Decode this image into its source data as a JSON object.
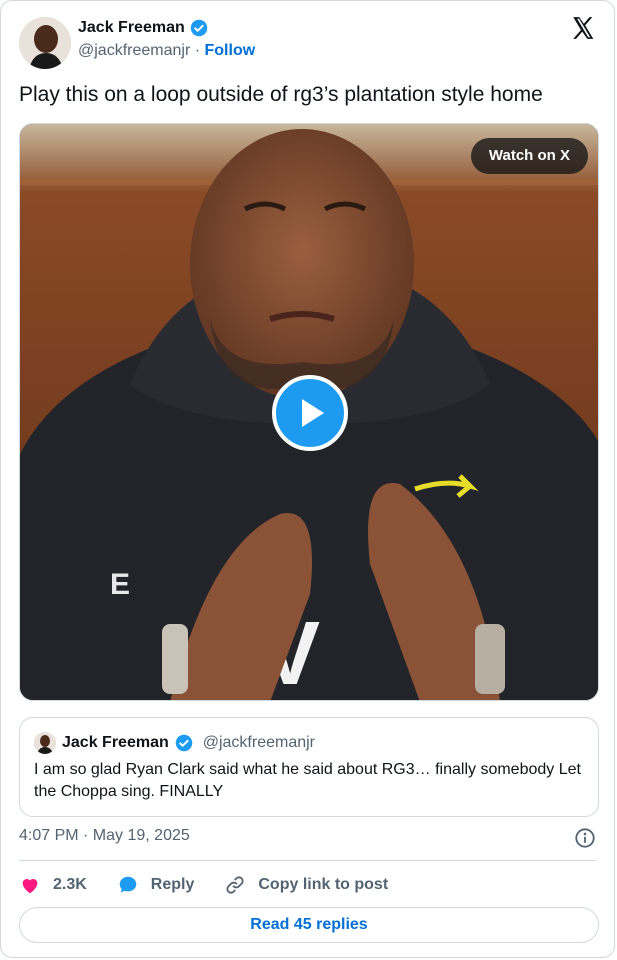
{
  "author": {
    "name": "Jack Freeman",
    "handle": "@jackfreemanjr",
    "separator": " · ",
    "follow_label": "Follow"
  },
  "tweet": {
    "text": "Play this on a loop outside of rg3’s plantation style home"
  },
  "media": {
    "watch_label": "Watch on X"
  },
  "quote": {
    "name": "Jack Freeman",
    "handle": "@jackfreemanjr",
    "text": "I am so glad Ryan Clark said what he said about RG3… finally somebody Let the Choppa sing. FINALLY"
  },
  "timestamp": "4:07 PM · May 19, 2025",
  "actions": {
    "likes": "2.3K",
    "reply_label": "Reply",
    "copy_label": "Copy link to post"
  },
  "read_replies_label": "Read 45 replies",
  "colors": {
    "accent": "#1d9bf0",
    "link": "#006fd6",
    "like": "#f91880",
    "muted": "#536471"
  }
}
